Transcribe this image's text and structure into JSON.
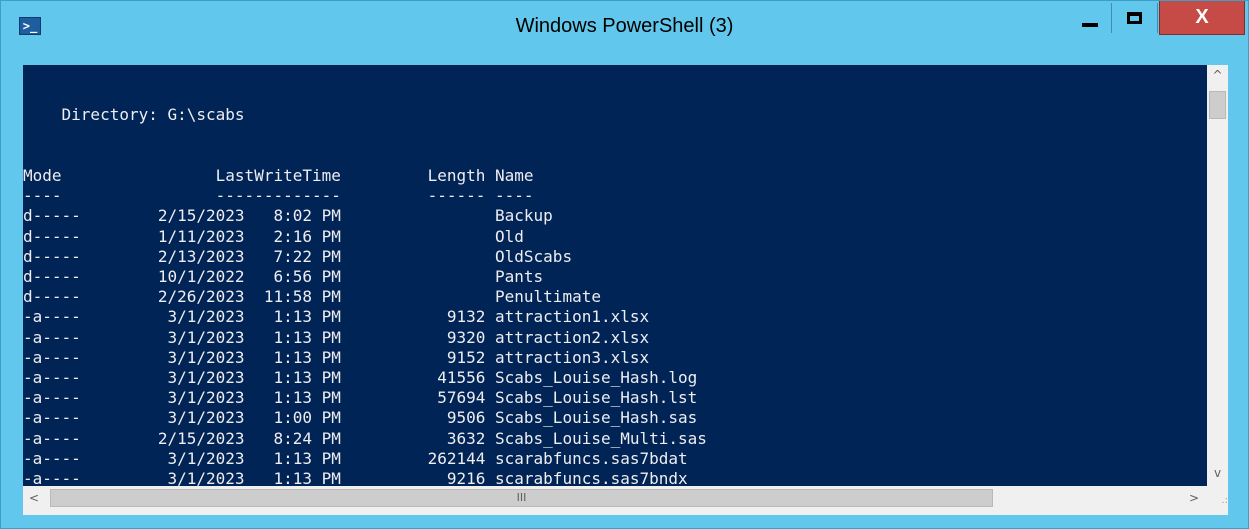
{
  "window": {
    "title": "Windows PowerShell (3)",
    "app_icon": "powershell-icon",
    "buttons": {
      "minimize": "_",
      "maximize": "□",
      "close": "X"
    }
  },
  "console": {
    "blank1": "",
    "blank2": "",
    "directory_line": "    Directory: G:\\scabs",
    "blank3": "",
    "blank4": "",
    "header_line": "Mode                LastWriteTime         Length Name",
    "underline_line": "----                -------------         ------ ----",
    "rows": [
      "d-----        2/15/2023   8:02 PM                Backup",
      "d-----        1/11/2023   2:16 PM                Old",
      "d-----        2/13/2023   7:22 PM                OldScabs",
      "d-----        10/1/2022   6:56 PM                Pants",
      "d-----        2/26/2023  11:58 PM                Penultimate",
      "-a----         3/1/2023   1:13 PM           9132 attraction1.xlsx",
      "-a----         3/1/2023   1:13 PM           9320 attraction2.xlsx",
      "-a----         3/1/2023   1:13 PM           9152 attraction3.xlsx",
      "-a----         3/1/2023   1:13 PM          41556 Scabs_Louise_Hash.log",
      "-a----         3/1/2023   1:13 PM          57694 Scabs_Louise_Hash.lst",
      "-a----         3/1/2023   1:00 PM           9506 Scabs_Louise_Hash.sas",
      "-a----        2/15/2023   8:24 PM           3632 Scabs_Louise_Multi.sas",
      "-a----         3/1/2023   1:13 PM         262144 scarabfuncs.sas7bdat",
      "-a----         3/1/2023   1:13 PM           9216 scarabfuncs.sas7bndx"
    ]
  },
  "scrollbars": {
    "up": "^",
    "down": "v",
    "left": "<",
    "right": ">",
    "h_thumb_grip": "III",
    "resize_grip": ".:"
  },
  "colors": {
    "console_bg": "#012456",
    "console_fg": "#eeedf0",
    "titlebar": "#62c7ec",
    "close_button": "#c64a45"
  }
}
